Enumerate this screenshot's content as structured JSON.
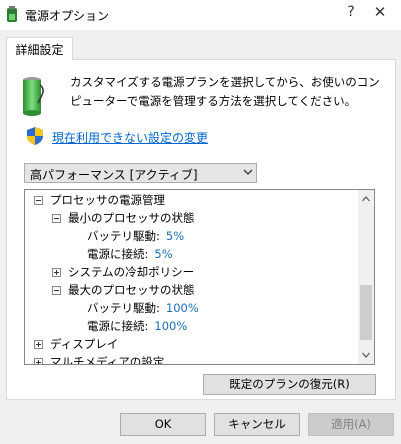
{
  "window": {
    "title": "電源オプション",
    "help_label": "?",
    "close_label": "✕",
    "icon": "power-options-icon"
  },
  "tab": {
    "label": "詳細設定"
  },
  "intro": {
    "text": "カスタマイズする電源プランを選択してから、お使いのコンピューターで電源を管理する方法を選択してください。",
    "icon": "battery-icon"
  },
  "link": {
    "label": "現在利用できない設定の変更",
    "icon": "uac-shield-icon"
  },
  "plan_select": {
    "value": "高パフォーマンス [アクティブ]"
  },
  "tree": {
    "items": [
      {
        "label": "プロセッサの電源管理",
        "expander": "−",
        "value": ""
      },
      {
        "label": "最小のプロセッサの状態",
        "expander": "−",
        "value": ""
      },
      {
        "label": "バッテリ駆動:",
        "expander": "",
        "value": "5%"
      },
      {
        "label": "電源に接続:",
        "expander": "",
        "value": "5%"
      },
      {
        "label": "システムの冷却ポリシー",
        "expander": "+",
        "value": ""
      },
      {
        "label": "最大のプロセッサの状態",
        "expander": "−",
        "value": ""
      },
      {
        "label": "バッテリ駆動:",
        "expander": "",
        "value": "100%"
      },
      {
        "label": "電源に接続:",
        "expander": "",
        "value": "100%"
      },
      {
        "label": "ディスプレイ",
        "expander": "+",
        "value": ""
      },
      {
        "label": "マルチメディアの設定",
        "expander": "+",
        "value": ""
      }
    ]
  },
  "buttons": {
    "restore": "既定のプランの復元(R)",
    "ok": "OK",
    "cancel": "キャンセル",
    "apply": "適用(A)"
  },
  "colors": {
    "link": "#0066cc",
    "value": "#1a6fb4",
    "button_face": "#e1e1e1",
    "disabled_text": "#838383"
  }
}
